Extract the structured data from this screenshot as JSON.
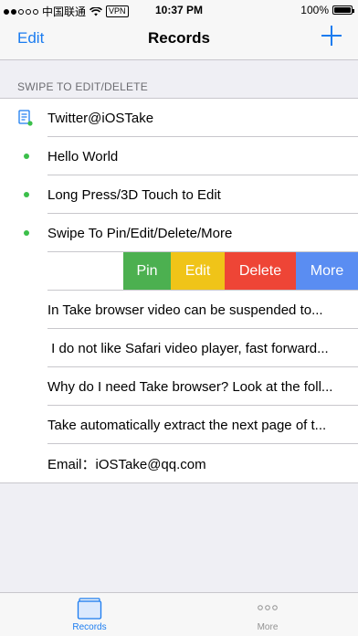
{
  "status_bar": {
    "carrier": "中国联通",
    "vpn": "VPN",
    "time": "10:37 PM",
    "battery": "100%"
  },
  "nav": {
    "edit_label": "Edit",
    "title": "Records"
  },
  "section_header": "SWIPE TO EDIT/DELETE",
  "rows": [
    "Twitter@iOSTake",
    "Hello World",
    "Long Press/3D Touch to Edit",
    "Swipe To Pin/Edit/Delete/More",
    "In Take browser video can be suspended to...",
    " I do not like Safari video player, fast forward...",
    "Why do I need Take browser? Look at the foll...",
    "Take automatically extract the next page of t...",
    "Email：iOSTake@qq.com"
  ],
  "swipe_actions": {
    "pin": "Pin",
    "edit": "Edit",
    "delete": "Delete",
    "more": "More"
  },
  "tabs": {
    "records": "Records",
    "more": "More"
  },
  "colors": {
    "accent": "#1b7cf0",
    "pin": "#4cb050",
    "edit": "#f0c418",
    "delete": "#ee4536",
    "more": "#5a8df2",
    "bullet": "#3bbf4a"
  }
}
